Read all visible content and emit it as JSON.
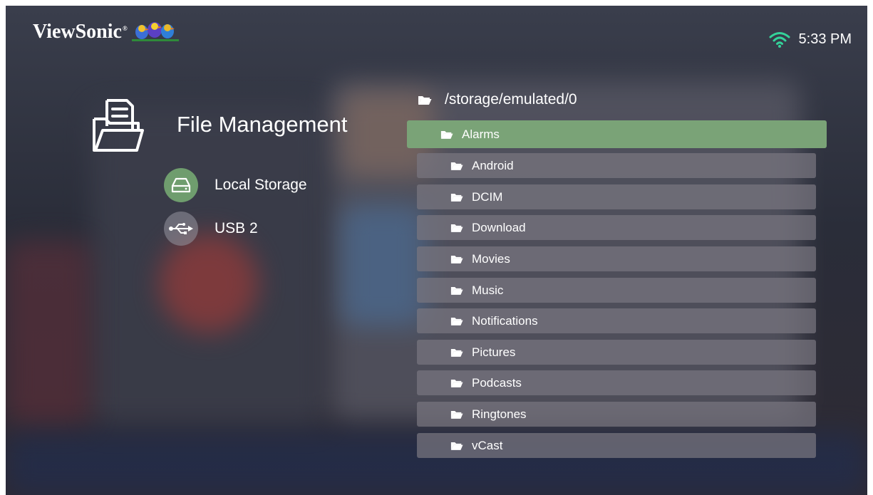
{
  "header": {
    "brand": "ViewSonic",
    "brand_mark": "®",
    "time": "5:33 PM"
  },
  "sidebar": {
    "title": "File Management",
    "sources": [
      {
        "label": "Local Storage",
        "icon": "hard-drive-icon",
        "selected": true
      },
      {
        "label": "USB 2",
        "icon": "usb-icon",
        "selected": false
      }
    ]
  },
  "browser": {
    "path": "/storage/emulated/0",
    "folders": [
      "Alarms",
      "Android",
      "DCIM",
      "Download",
      "Movies",
      "Music",
      "Notifications",
      "Pictures",
      "Podcasts",
      "Ringtones",
      "vCast"
    ],
    "selected_folder": "Alarms"
  },
  "colors": {
    "selected_green": "#7aa377",
    "local_storage_circle": "#6f9d6e",
    "wifi_green": "#34d39a",
    "row_gray": "#78767f"
  }
}
